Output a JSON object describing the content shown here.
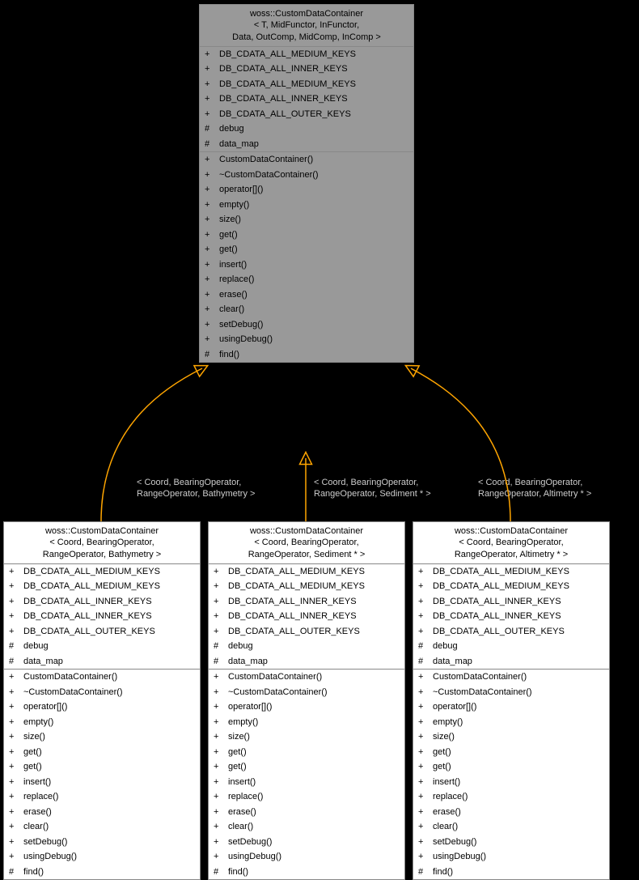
{
  "parent": {
    "title_l1": "woss::CustomDataContainer",
    "title_l2": "< T, MidFunctor, InFunctor,",
    "title_l3": " Data, OutComp, MidComp, InComp >",
    "attrs": [
      {
        "vis": "+",
        "name": "DB_CDATA_ALL_MEDIUM_KEYS"
      },
      {
        "vis": "+",
        "name": "DB_CDATA_ALL_INNER_KEYS"
      },
      {
        "vis": "+",
        "name": "DB_CDATA_ALL_MEDIUM_KEYS"
      },
      {
        "vis": "+",
        "name": "DB_CDATA_ALL_INNER_KEYS"
      },
      {
        "vis": "+",
        "name": "DB_CDATA_ALL_OUTER_KEYS"
      },
      {
        "vis": "#",
        "name": "debug"
      },
      {
        "vis": "#",
        "name": "data_map"
      }
    ],
    "methods": [
      {
        "vis": "+",
        "name": "CustomDataContainer()"
      },
      {
        "vis": "+",
        "name": "~CustomDataContainer()"
      },
      {
        "vis": "+",
        "name": "operator[]()"
      },
      {
        "vis": "+",
        "name": "empty()"
      },
      {
        "vis": "+",
        "name": "size()"
      },
      {
        "vis": "+",
        "name": "get()"
      },
      {
        "vis": "+",
        "name": "get()"
      },
      {
        "vis": "+",
        "name": "insert()"
      },
      {
        "vis": "+",
        "name": "replace()"
      },
      {
        "vis": "+",
        "name": "erase()"
      },
      {
        "vis": "+",
        "name": "clear()"
      },
      {
        "vis": "+",
        "name": "setDebug()"
      },
      {
        "vis": "+",
        "name": "usingDebug()"
      },
      {
        "vis": "#",
        "name": "find()"
      }
    ]
  },
  "children": [
    {
      "title_l1": "woss::CustomDataContainer",
      "title_l2": "< Coord, BearingOperator,",
      "title_l3": " RangeOperator, Bathymetry >",
      "edge_l1": "< Coord, BearingOperator,",
      "edge_l2": " RangeOperator, Bathymetry >"
    },
    {
      "title_l1": "woss::CustomDataContainer",
      "title_l2": "< Coord, BearingOperator,",
      "title_l3": " RangeOperator, Sediment * >",
      "edge_l1": "< Coord, BearingOperator,",
      "edge_l2": " RangeOperator, Sediment * >"
    },
    {
      "title_l1": "woss::CustomDataContainer",
      "title_l2": "< Coord, BearingOperator,",
      "title_l3": " RangeOperator, Altimetry * >",
      "edge_l1": "< Coord, BearingOperator,",
      "edge_l2": " RangeOperator, Altimetry * >"
    }
  ],
  "child_attrs": [
    {
      "vis": "+",
      "name": "DB_CDATA_ALL_MEDIUM_KEYS"
    },
    {
      "vis": "+",
      "name": "DB_CDATA_ALL_MEDIUM_KEYS"
    },
    {
      "vis": "+",
      "name": "DB_CDATA_ALL_INNER_KEYS"
    },
    {
      "vis": "+",
      "name": "DB_CDATA_ALL_INNER_KEYS"
    },
    {
      "vis": "+",
      "name": "DB_CDATA_ALL_OUTER_KEYS"
    },
    {
      "vis": "#",
      "name": "debug"
    },
    {
      "vis": "#",
      "name": "data_map"
    }
  ],
  "child_methods": [
    {
      "vis": "+",
      "name": "CustomDataContainer()"
    },
    {
      "vis": "+",
      "name": "~CustomDataContainer()"
    },
    {
      "vis": "+",
      "name": "operator[]()"
    },
    {
      "vis": "+",
      "name": "empty()"
    },
    {
      "vis": "+",
      "name": "size()"
    },
    {
      "vis": "+",
      "name": "get()"
    },
    {
      "vis": "+",
      "name": "get()"
    },
    {
      "vis": "+",
      "name": "insert()"
    },
    {
      "vis": "+",
      "name": "replace()"
    },
    {
      "vis": "+",
      "name": "erase()"
    },
    {
      "vis": "+",
      "name": "clear()"
    },
    {
      "vis": "+",
      "name": "setDebug()"
    },
    {
      "vis": "+",
      "name": "usingDebug()"
    },
    {
      "vis": "#",
      "name": "find()"
    }
  ]
}
